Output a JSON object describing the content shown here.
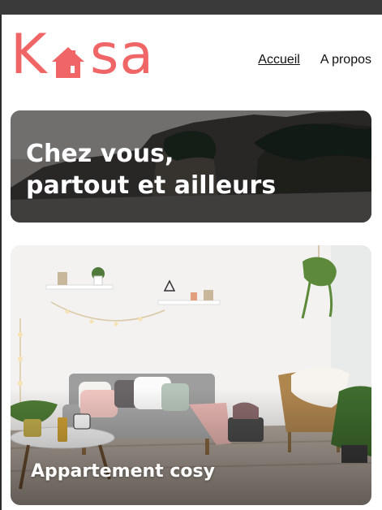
{
  "brand": {
    "logo_text_k": "K",
    "logo_text_sa": "sa",
    "accent_color": "#f06667"
  },
  "nav": {
    "items": [
      {
        "label": "Accueil",
        "active": true
      },
      {
        "label": "A propos",
        "active": false
      }
    ]
  },
  "banner": {
    "title_line1": "Chez vous,",
    "title_line2": "partout et ailleurs"
  },
  "listings": [
    {
      "title": "Appartement cosy"
    }
  ]
}
